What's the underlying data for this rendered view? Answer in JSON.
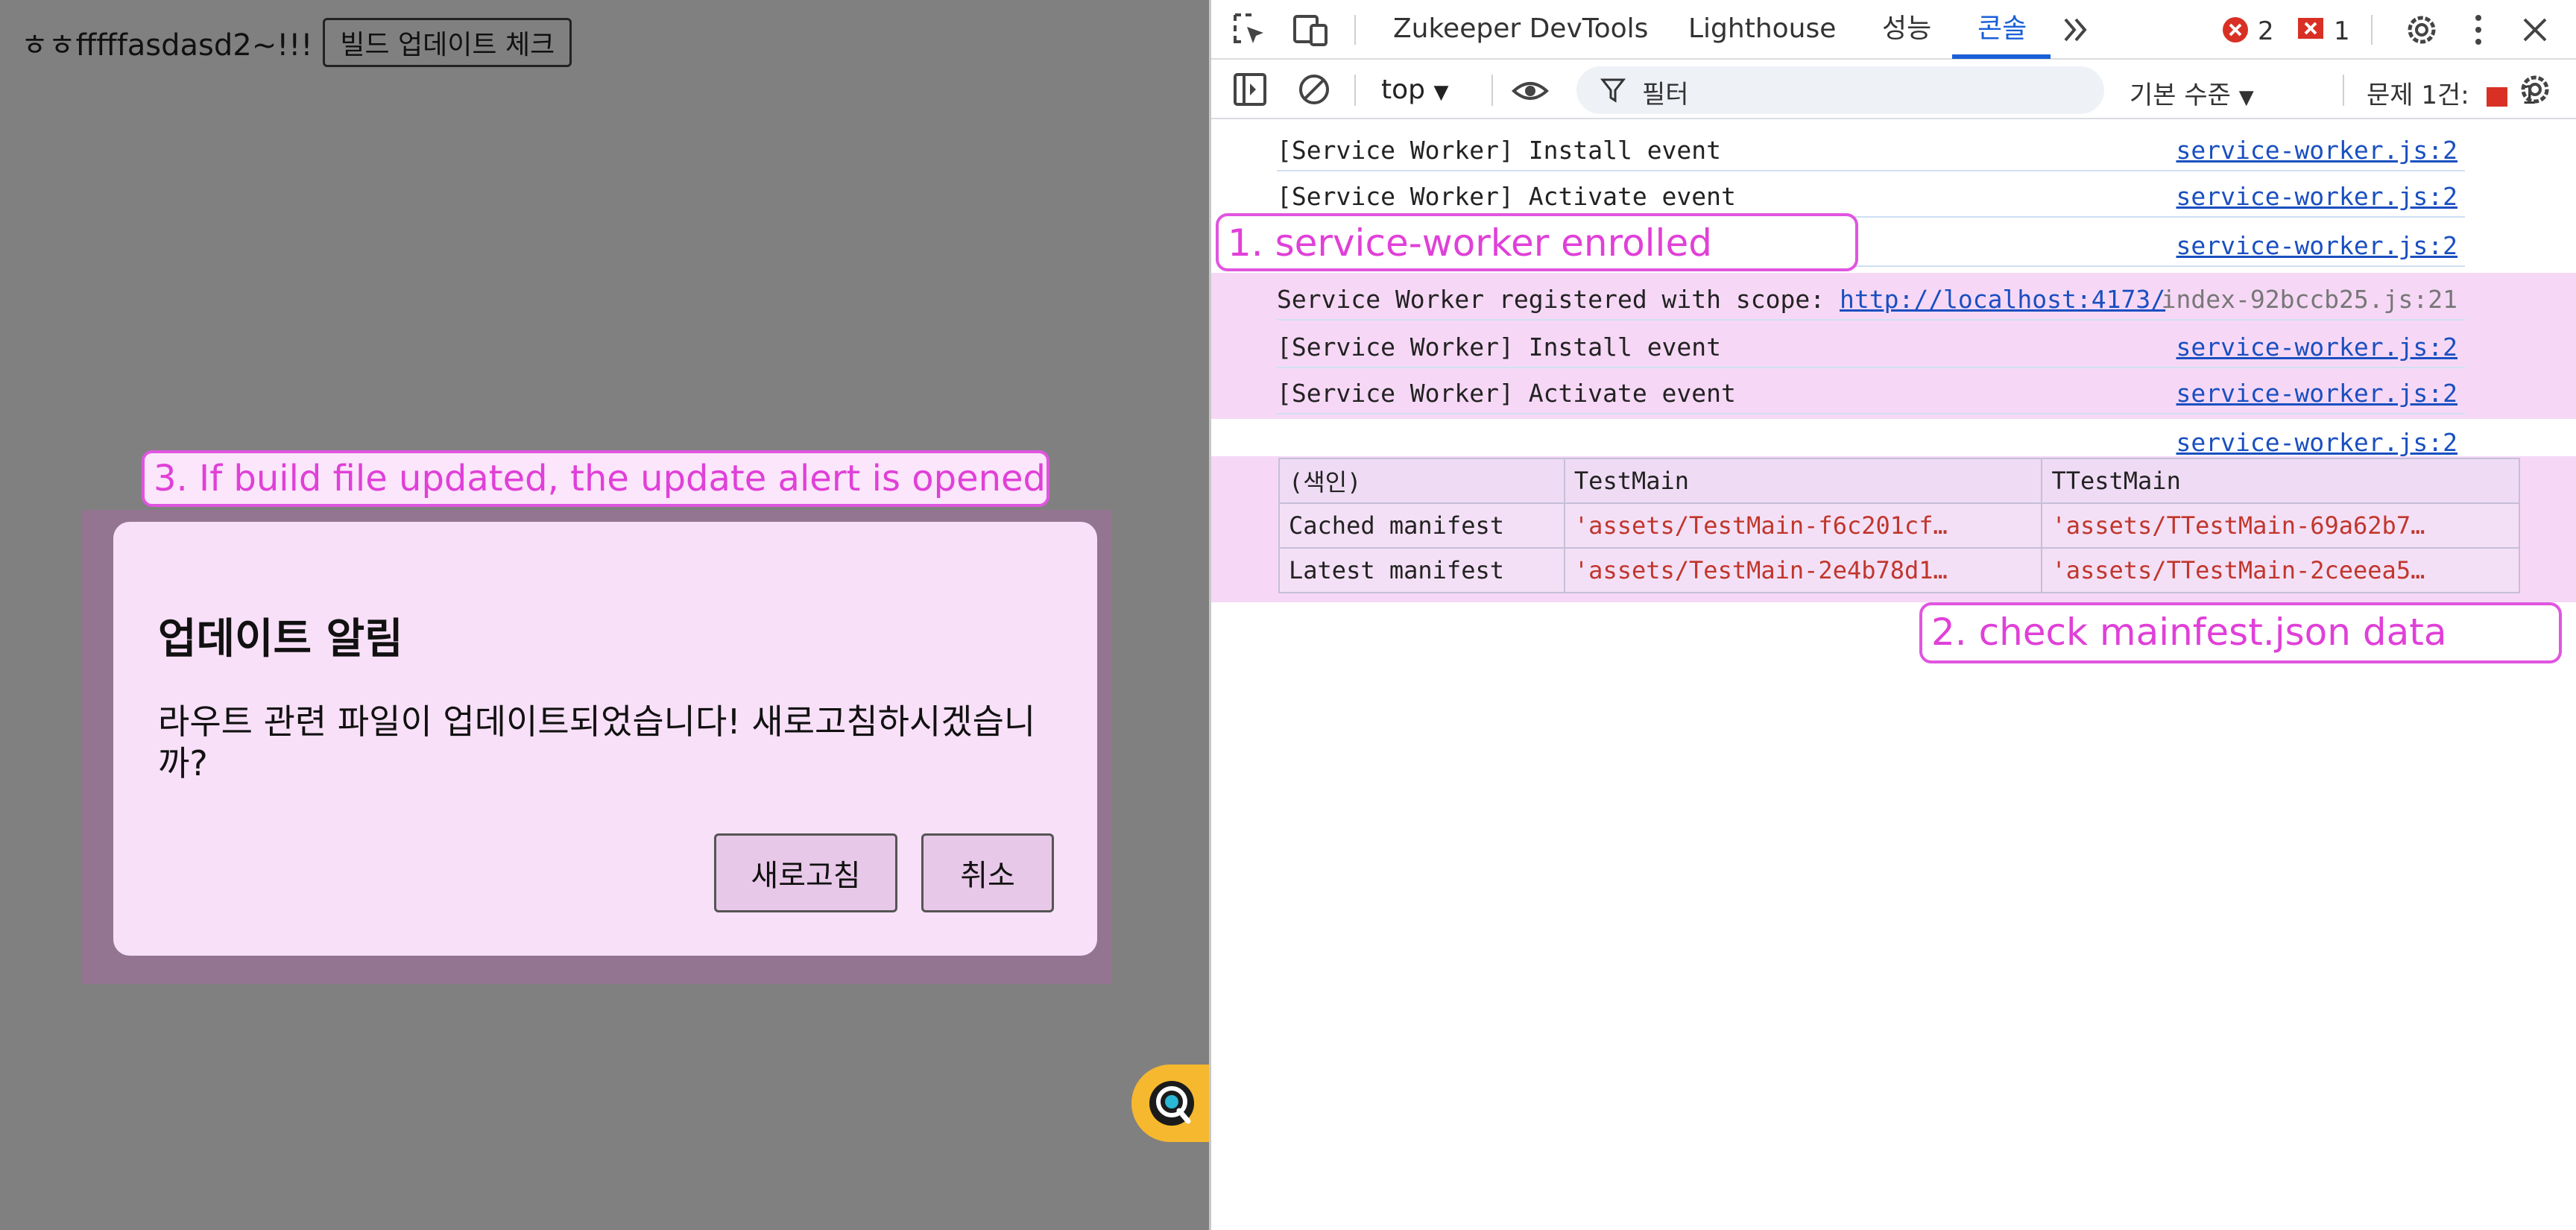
{
  "page": {
    "title": "ㅎㅎfffffasdasd2~!!!",
    "build_check_button": "빌드 업데이트 체크"
  },
  "modal": {
    "title": "업데이트 알림",
    "message": "라우트 관련 파일이 업데이트되었습니다! 새로고침하시겠습니까?",
    "refresh_button": "새로고침",
    "cancel_button": "취소"
  },
  "annotations": {
    "step1": "1. service-worker enrolled",
    "step2": "2. check mainfest.json data",
    "step3": "3. If build file updated, the update alert is opened"
  },
  "devtools": {
    "tabs": [
      "Zukeeper DevTools",
      "Lighthouse",
      "성능",
      "콘솔"
    ],
    "active_tab": "콘솔",
    "more_tabs_icon": "double-chevron-right-icon",
    "error_count": "2",
    "issue_count": "1",
    "toolbar": {
      "context": "top",
      "filter_placeholder": "필터",
      "level": "기본 수준",
      "issues_label": "문제 1건:",
      "issues_count": "1"
    },
    "console_lines": [
      {
        "text": "[Service Worker] Install event",
        "source": "service-worker.js:2"
      },
      {
        "text": "[Service Worker] Activate event",
        "source": "service-worker.js:2"
      },
      {
        "text": "",
        "source": "service-worker.js:2"
      },
      {
        "text": "Service Worker registered with scope: ",
        "link": "http://localhost:4173/",
        "source": "index-92bccb25.js:21"
      },
      {
        "text": "[Service Worker] Install event",
        "source": "service-worker.js:2"
      },
      {
        "text": "[Service Worker] Activate event",
        "source": "service-worker.js:2"
      },
      {
        "text": "",
        "source": "service-worker.js:2"
      }
    ],
    "table": {
      "headers": [
        "(색인)",
        "TestMain",
        "TTestMain"
      ],
      "rows": [
        [
          "Cached manifest",
          "'assets/TestMain-f6c201cf…",
          "'assets/TTestMain-69a62b7…"
        ],
        [
          "Latest manifest",
          "'assets/TestMain-2e4b78d1…",
          "'assets/TTestMain-2ceeea5…"
        ]
      ]
    }
  },
  "colors": {
    "annotation": "#e055e0",
    "modal_bg": "#f8e0f8",
    "link": "#1a4fc0",
    "active_tab": "#1a5fd8",
    "error_red": "#d93025"
  }
}
